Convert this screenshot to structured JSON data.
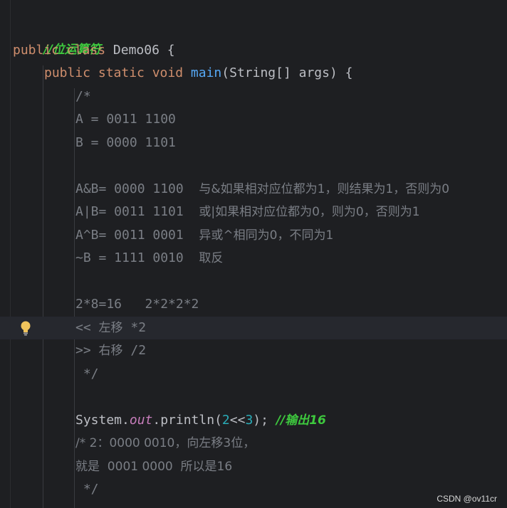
{
  "code": {
    "line_01": "//位运算符",
    "line_02_kw": "public class ",
    "line_02_name": "Demo06 {",
    "line_03_kw1": "public static void ",
    "line_03_fn": "main",
    "line_03_rest": "(String[] args) {",
    "line_04": "/*",
    "line_05": "A = 0011 1100",
    "line_06": "B = 0000 1101",
    "line_08_code": "A&B= 0000 1100  ",
    "line_08_cn": "与&如果相对应位都为1，则结果为1，否则为0",
    "line_09_code": "A|B= 0011 1101  ",
    "line_09_cn": "或|如果相对应位都为0，则为0，否则为1",
    "line_10_code": "A^B= 0011 0001  ",
    "line_10_cn": "异或^相同为0，不同为1",
    "line_11_code": "~B = 1111 0010  ",
    "line_11_cn": "取反",
    "line_13": "2*8=16   2*2*2*2",
    "line_14_a": "<< ",
    "line_14_cn": "左移",
    "line_14_b": " *2",
    "line_15_a": ">> ",
    "line_15_cn": "右移",
    "line_15_b": " /2",
    "line_16": " */",
    "line_18_sys": "System.",
    "line_18_out": "out",
    "line_18_println": ".println(",
    "line_18_n1": "2",
    "line_18_op": "<<",
    "line_18_n2": "3",
    "line_18_close": "); ",
    "line_18_cmt": "//输出16",
    "line_19": "/* 2：0000 0010，向左移3位，",
    "line_20": "就是  0001 0000  所以是16",
    "line_21": " */"
  },
  "watermark": "CSDN @ov11cr",
  "colors": {
    "background": "#1e1f22",
    "keyword": "#cf8e6d",
    "function": "#56a8f5",
    "field": "#c77dbb",
    "number": "#2aacb8",
    "comment": "#7a7e85",
    "highlight_comment": "#3ec93e",
    "text": "#bcbec4"
  },
  "icons": {
    "intention_bulb": "lightbulb-icon"
  }
}
